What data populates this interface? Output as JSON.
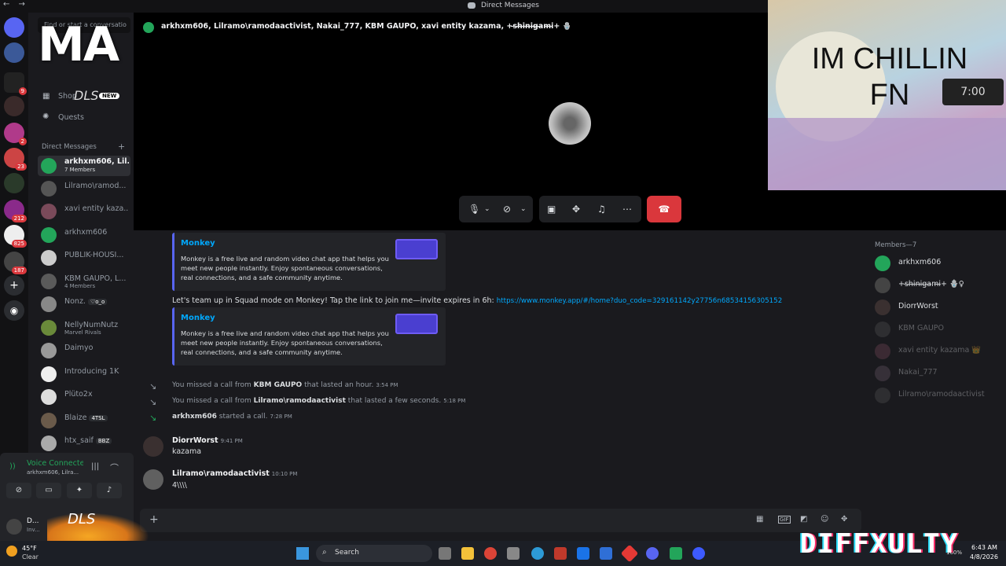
{
  "window": {
    "title": "Direct Messages",
    "nav": "← →"
  },
  "rail": {
    "servers": [
      {
        "badge": ""
      },
      {
        "badge": ""
      },
      {
        "badge": "9"
      },
      {
        "badge": ""
      },
      {
        "badge": "2"
      },
      {
        "badge": "23"
      },
      {
        "badge": ""
      },
      {
        "badge": "212"
      },
      {
        "badge": "825"
      },
      {
        "badge": "187"
      }
    ]
  },
  "sidebar": {
    "search_placeholder": "Find or start a conversation",
    "shop_label": "Shop",
    "shop_badge": "NEW",
    "quests_label": "Quests",
    "dm_header": "Direct Messages",
    "dms": [
      {
        "name": "arkhxm606, Lil...",
        "sub": "7 Members",
        "tag": ""
      },
      {
        "name": "Lilramo\\ramod...",
        "sub": "",
        "tag": ""
      },
      {
        "name": "xavi entity kaza...",
        "sub": "",
        "tag": ""
      },
      {
        "name": "arkhxm606",
        "sub": "",
        "tag": ""
      },
      {
        "name": "PUBLIK-HOUSI...",
        "sub": "",
        "tag": ""
      },
      {
        "name": "KBM GAUPO, L...",
        "sub": "4 Members",
        "tag": ""
      },
      {
        "name": "Nonz.",
        "sub": "",
        "tag": "♡o_o"
      },
      {
        "name": "NellyNumNutz",
        "sub": "Marvel Rivals",
        "tag": ""
      },
      {
        "name": "Daimyo",
        "sub": "",
        "tag": ""
      },
      {
        "name": "Introducing 1K",
        "sub": "",
        "tag": ""
      },
      {
        "name": "Plüto2x",
        "sub": "",
        "tag": ""
      },
      {
        "name": "Blaize",
        "sub": "",
        "tag": "4TSL"
      },
      {
        "name": "htx_saif",
        "sub": "",
        "tag": "BBZ"
      }
    ],
    "voice": {
      "title": "Voice Connected",
      "sub": "arkhxm606, Lilra..."
    },
    "user": {
      "name": "D...",
      "status": "Inv..."
    }
  },
  "call": {
    "participants_header": "arkhxm606, Lilramo\\ramodaactivist, Nakai_777, KBM GAUPO, xavi entity kazama, +s̶h̶i̶n̶i̶g̶a̶m̶i̶+ 🪬♀",
    "overlay_text": "IM CHILLIN FN",
    "overlay_clock": "7:00"
  },
  "chat": {
    "embed_title": "Monkey",
    "embed_desc": "Monkey is a free live and random video chat app that helps you meet new people instantly. Enjoy spontaneous conversations, real connections, and a safe community anytime.",
    "invite_text": "Let's team up in Squad mode on Monkey! Tap the link to join me—invite expires in 6h:",
    "invite_link": "https://www.monkey.app/#/home?duo_code=329161142y27756n68534156305152",
    "system": [
      {
        "pre": "You missed a call from",
        "who": "KBM GAUPO",
        "post": "that lasted an hour.",
        "time": "3:54 PM"
      },
      {
        "pre": "You missed a call from",
        "who": "Lilramo\\ramodaactivist",
        "post": "that lasted a few seconds.",
        "time": "5:18 PM"
      },
      {
        "pre": "",
        "who": "arkhxm606",
        "post": "started a call.",
        "time": "7:28 PM"
      }
    ],
    "messages": [
      {
        "author": "DiorrWorst",
        "time": "9:41 PM",
        "text": "kazama"
      },
      {
        "author": "Lilramo\\ramodaactivist",
        "time": "10:10 PM",
        "text": "4\\\\\\\\"
      }
    ]
  },
  "members": {
    "header": "Members—7",
    "list": [
      {
        "name": "arkhxm606",
        "online": true
      },
      {
        "name": "+s̶h̶i̶n̶i̶g̶a̶m̶i̶+ 🪬♀",
        "online": true
      },
      {
        "name": "DiorrWorst",
        "online": true
      },
      {
        "name": "KBM GAUPO",
        "online": false
      },
      {
        "name": "xavi entity kazama 👑",
        "online": false
      },
      {
        "name": "Nakai_777",
        "online": false
      },
      {
        "name": "Lilramo\\ramodaactivist",
        "online": false
      }
    ]
  },
  "taskbar": {
    "weather_temp": "45°F",
    "weather_desc": "Clear",
    "search_label": "Search",
    "time": "6:43 AM",
    "date": "4/8/2026",
    "battery": "100%"
  },
  "watermarks": {
    "top_left": "MA",
    "dls": "DLS",
    "bottom_right": "DIFFXULTY"
  },
  "colors": {
    "accent": "#5865f2",
    "link": "#00a8fc",
    "hangup": "#da373c",
    "online": "#23a55a"
  }
}
